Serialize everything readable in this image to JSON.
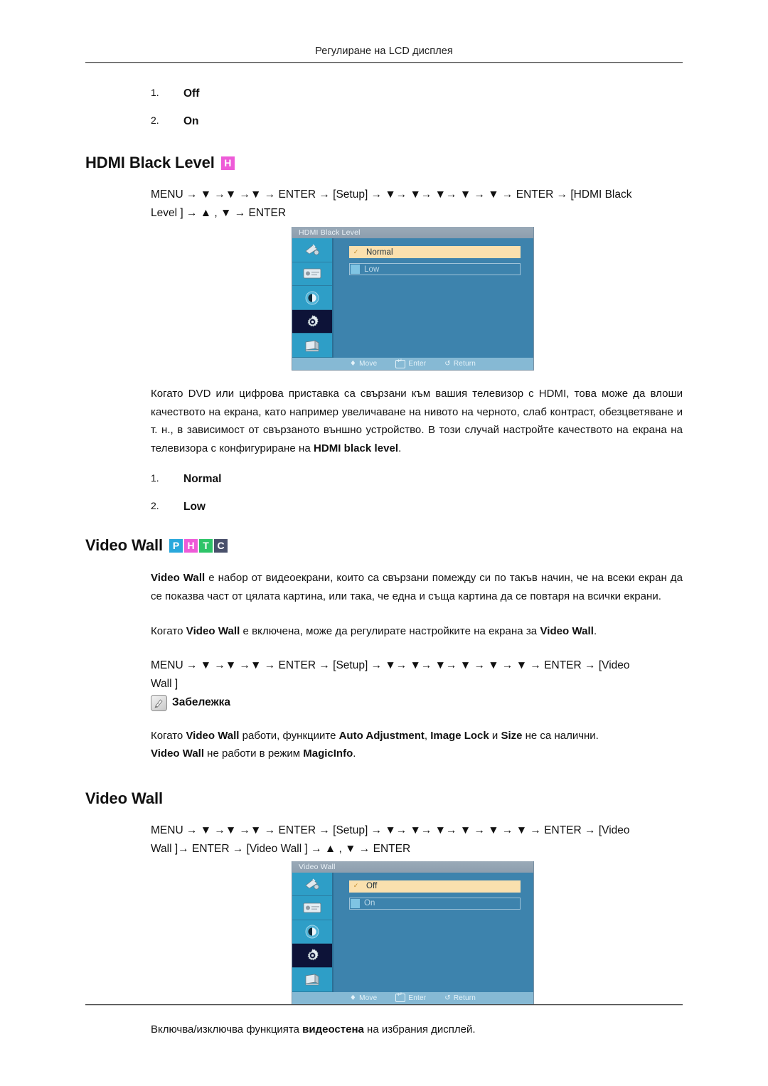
{
  "page": {
    "running_head": "Регулиране на LCD дисплея"
  },
  "top_list": {
    "items": [
      {
        "num": "1.",
        "label": "Off"
      },
      {
        "num": "2.",
        "label": "On"
      }
    ]
  },
  "hdmi_black_level": {
    "heading": "HDMI Black Level",
    "badges": [
      {
        "letter": "H",
        "color": "#ee5bd8",
        "name": "badge-h"
      }
    ],
    "path_line1": "MENU → ▼ →▼ →▼ → ENTER → [Setup] → ▼→ ▼→ ▼→ ▼ → ▼ → ENTER → [HDMI Black",
    "path_line2": "Level ] → ▲ , ▼ → ENTER",
    "osd": {
      "title": "HDMI Black Level",
      "options": [
        {
          "label": "Normal",
          "selected": true
        },
        {
          "label": "Low",
          "selected": false
        }
      ],
      "footer": [
        {
          "label": "Move",
          "icon": "diamond-updown-icon"
        },
        {
          "label": "Enter",
          "icon": "enter-key-icon"
        },
        {
          "label": "Return",
          "icon": "return-arrow-icon"
        }
      ],
      "sidebar_icons": [
        "input-source-icon",
        "picture-monitor-icon",
        "contrast-circle-icon",
        "setup-gear-icon",
        "multi-control-display-icon"
      ],
      "active_sidebar_index": 3
    },
    "paragraph": "Когато DVD или цифрова приставка са свързани към вашия телевизор с HDMI, това може да влоши качеството на екрана, като например увеличаване на нивото на черното, слаб контраст, обезцветяване и т. н., в зависимост от свързаното външно устройство. В този случай настройте качеството на екрана на телевизора с конфигуриране на ",
    "paragraph_bold_tail": "HDMI black level",
    "paragraph_end": ".",
    "options_list": [
      {
        "num": "1.",
        "label": "Normal"
      },
      {
        "num": "2.",
        "label": "Low"
      }
    ]
  },
  "video_wall": {
    "heading": "Video Wall",
    "badges": [
      {
        "letter": "P",
        "color": "#29a8dc",
        "name": "badge-p"
      },
      {
        "letter": "H",
        "color": "#ee5bd8",
        "name": "badge-h"
      },
      {
        "letter": "T",
        "color": "#2dc468",
        "name": "badge-t"
      },
      {
        "letter": "C",
        "color": "#49506b",
        "name": "badge-c"
      }
    ],
    "para1_a": "Video Wall",
    "para1_b": " е набор от видеоекрани, които са свързани помежду си по такъв начин, че на всеки екран да се показва част от цялата картина, или така, че една и съща картина да се повтаря на всички екрани.",
    "para2_a": "Когато ",
    "para2_b": "Video Wall",
    "para2_c": " е включена, може да регулирате настройките на екрана за ",
    "para2_d": "Video Wall",
    "para2_e": ".",
    "path_line1": "MENU → ▼ →▼ →▼ → ENTER → [Setup] → ▼→ ▼→ ▼→ ▼ → ▼ → ▼ → ENTER → [Video",
    "path_line2": "Wall ]",
    "note": {
      "title": "Забележка",
      "icon": "note-pen-icon",
      "line1_a": "Когато ",
      "line1_b": "Video Wall",
      "line1_c": " работи, функциите  ",
      "line1_d": "Auto Adjustment",
      "line1_e": ", ",
      "line1_f": "Image Lock",
      "line1_g": " и ",
      "line1_h": "Size",
      "line1_i": " не са налични.",
      "line2_a": "Video Wall",
      "line2_b": " не работи в режим ",
      "line2_c": "MagicInfo",
      "line2_d": "."
    }
  },
  "video_wall_sub": {
    "heading": "Video Wall",
    "path_line1": "MENU → ▼ →▼ →▼ → ENTER → [Setup] → ▼→ ▼→ ▼→ ▼ → ▼ → ▼ → ENTER → [Video",
    "path_line2": "Wall ]→ ENTER → [Video Wall ] → ▲ , ▼ → ENTER",
    "osd": {
      "title": "Video Wall",
      "options": [
        {
          "label": "Off",
          "selected": true
        },
        {
          "label": "On",
          "selected": false
        }
      ],
      "footer": [
        {
          "label": "Move",
          "icon": "diamond-updown-icon"
        },
        {
          "label": "Enter",
          "icon": "enter-key-icon"
        },
        {
          "label": "Return",
          "icon": "return-arrow-icon"
        }
      ],
      "sidebar_icons": [
        "input-source-icon",
        "picture-monitor-icon",
        "contrast-circle-icon",
        "setup-gear-icon",
        "multi-control-display-icon"
      ],
      "active_sidebar_index": 3
    },
    "caption_a": "Включва/изключва функцията ",
    "caption_b": "видеостена",
    "caption_c": " на избрания дисплей."
  }
}
